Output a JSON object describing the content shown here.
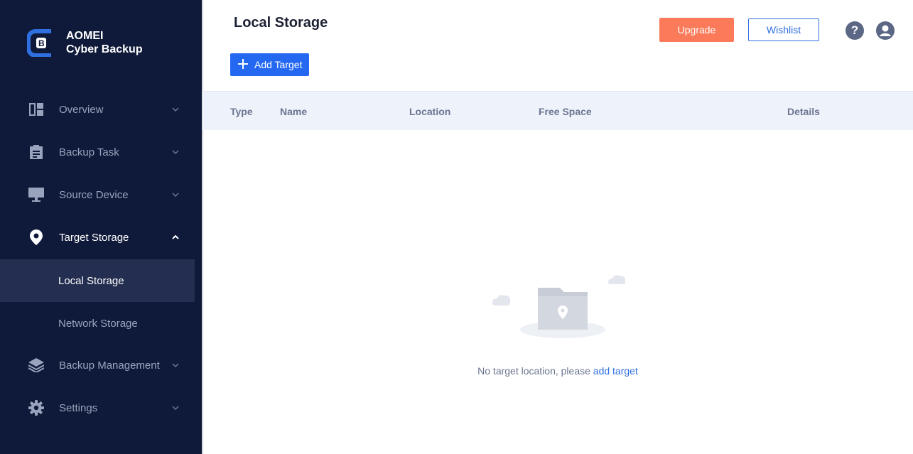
{
  "app": {
    "brand_line1": "AOMEI",
    "brand_line2": "Cyber Backup"
  },
  "sidebar": {
    "items": [
      {
        "label": "Overview",
        "icon": "dashboard-icon"
      },
      {
        "label": "Backup Task",
        "icon": "clipboard-icon"
      },
      {
        "label": "Source Device",
        "icon": "monitor-icon"
      },
      {
        "label": "Target Storage",
        "icon": "location-pin-icon",
        "expanded": true,
        "children": [
          {
            "label": "Local Storage",
            "active": true
          },
          {
            "label": "Network Storage",
            "active": false
          }
        ]
      },
      {
        "label": "Backup Management",
        "icon": "layers-icon"
      },
      {
        "label": "Settings",
        "icon": "gear-icon"
      }
    ]
  },
  "header": {
    "title": "Local Storage",
    "upgrade_label": "Upgrade",
    "wishlist_label": "Wishlist",
    "help_glyph": "?"
  },
  "toolbar": {
    "add_target_label": "Add Target"
  },
  "table": {
    "columns": [
      "Type",
      "Name",
      "Location",
      "Free Space",
      "Details"
    ]
  },
  "empty_state": {
    "message": "No target location, please",
    "link_label": "add target"
  },
  "colors": {
    "sidebar_bg": "#0f1a3a",
    "accent_blue": "#2468f2",
    "upgrade_orange": "#fa7a59",
    "table_header_bg": "#eef2fa"
  }
}
